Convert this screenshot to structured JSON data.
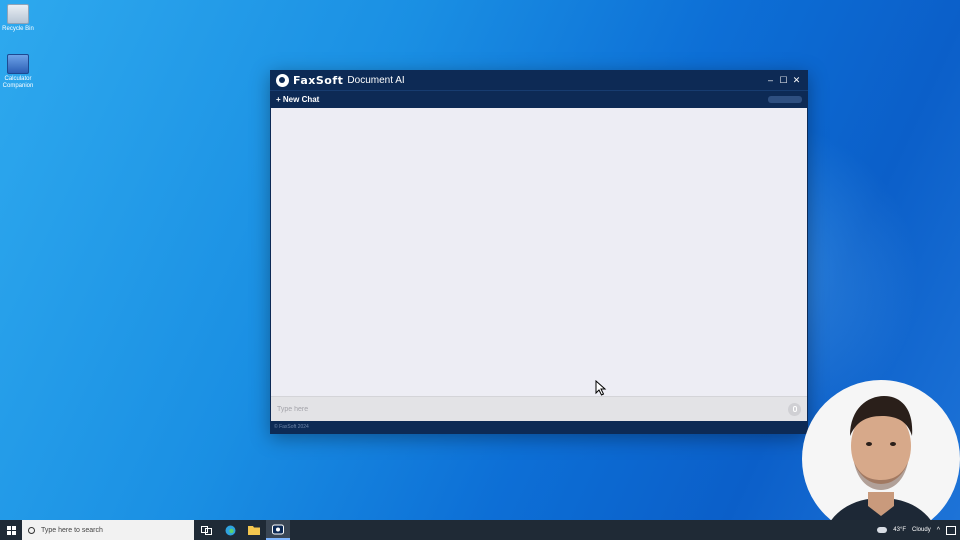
{
  "desktop": {
    "icons": [
      {
        "label": "Recycle Bin"
      },
      {
        "label": "Calculator Companion"
      }
    ]
  },
  "window": {
    "brand": "FaxSoft",
    "title": "Document AI",
    "controls": {
      "minimize": "–",
      "maximize": "☐",
      "close": "✕"
    },
    "toolbar": {
      "new_chat": "+ New Chat"
    },
    "input": {
      "placeholder": "Type here"
    },
    "footer": "© FaxSoft 2024"
  },
  "taskbar": {
    "search_placeholder": "Type here to search",
    "weather_temp": "43°F",
    "weather_desc": "Cloudy"
  },
  "colors": {
    "window_navy": "#0d2a55",
    "chat_bg": "#ededf4",
    "taskbar": "#1f2a36"
  }
}
